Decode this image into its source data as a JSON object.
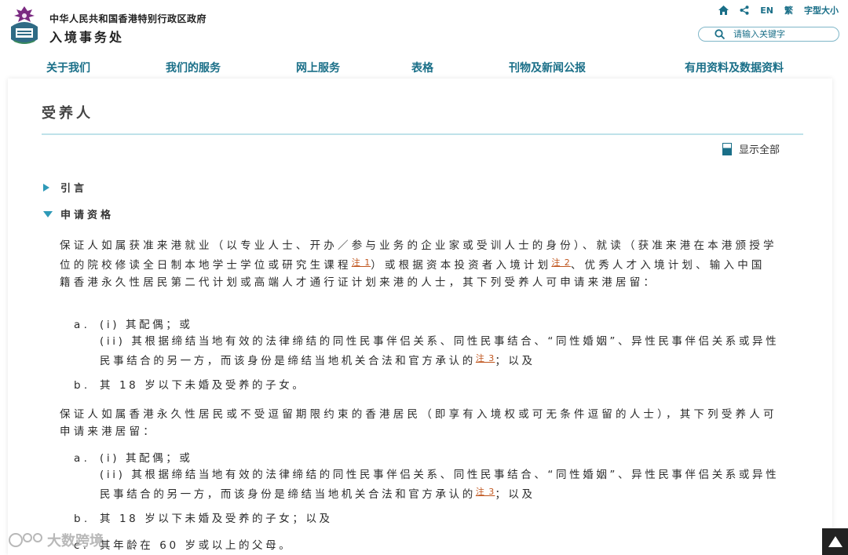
{
  "header": {
    "gov_title": "中华人民共和国香港特别行政区政府",
    "dept_title": "入境事务处",
    "tools": {
      "lang_en": "EN",
      "lang_trad": "繁",
      "font_size": "字型大小"
    },
    "search": {
      "placeholder": "请输入关键字"
    }
  },
  "nav": {
    "items": [
      "关于我们",
      "我们的服务",
      "网上服务",
      "表格",
      "刊物及新闻公报",
      "有用资料及数据资料"
    ]
  },
  "main": {
    "title": "受养人",
    "show_all": "显示全部",
    "sections": [
      {
        "label": "引言",
        "state": "collapsed"
      },
      {
        "label": "申请资格",
        "state": "expanded"
      }
    ],
    "block1": {
      "intro_part1": "保证人如属获准来港就业（以专业人士、开办／参与业务的企业家或受训人士的身份）、就读（获准来港在本港颁授学位的院校修读全日制本地学士学位或研究生课程",
      "note1": "注 1",
      "intro_part2": "）或根据资本投资者入境计划",
      "note2": "注 2",
      "intro_part3": "、优秀人才入境计划、输入中国籍香港永久性居民第二代计划或高端人才通行证计划来港的人士，其下列受养人可申请来港居留：",
      "a_marker": "a .",
      "a_i": "(i) 其配偶；或",
      "a_ii": "(ii) 其根据缔结当地有效的法律缔结的同性民事伴侣关系、同性民事结合、“同性婚姻”、异性民事伴侣关系或异性民事结合的另一方，而该身份是缔结当地机关合法和官方承认的",
      "a_note": "注 3",
      "a_end": "；以及",
      "b_marker": "b .",
      "b_text": "其 18 岁以下未婚及受养的子女。"
    },
    "block2": {
      "intro": "保证人如属香港永久性居民或不受逗留期限约束的香港居民（即享有入境权或可无条件逗留的人士），其下列受养人可申请来港居留：",
      "a_marker": "a .",
      "a_i": "(i) 其配偶；或",
      "a_ii": "(ii) 其根据缔结当地有效的法律缔结的同性民事伴侣关系、同性民事结合、“同性婚姻”、异性民事伴侣关系或异性民事结合的另一方，而该身份是缔结当地机关合法和官方承认的",
      "a_note": "注 3",
      "a_end": "；以及",
      "b_marker": "b .",
      "b_text": "其 18 岁以下未婚及受养的子女；以及",
      "c_marker": "c .",
      "c_text": "其年龄在 60 岁或以上的父母。"
    }
  },
  "watermark": {
    "text": "大数跨境"
  },
  "colors": {
    "accent": "#1a6f88",
    "arrow": "#2e9ab8",
    "note": "#c0561e",
    "rule": "#bfe2ea"
  }
}
